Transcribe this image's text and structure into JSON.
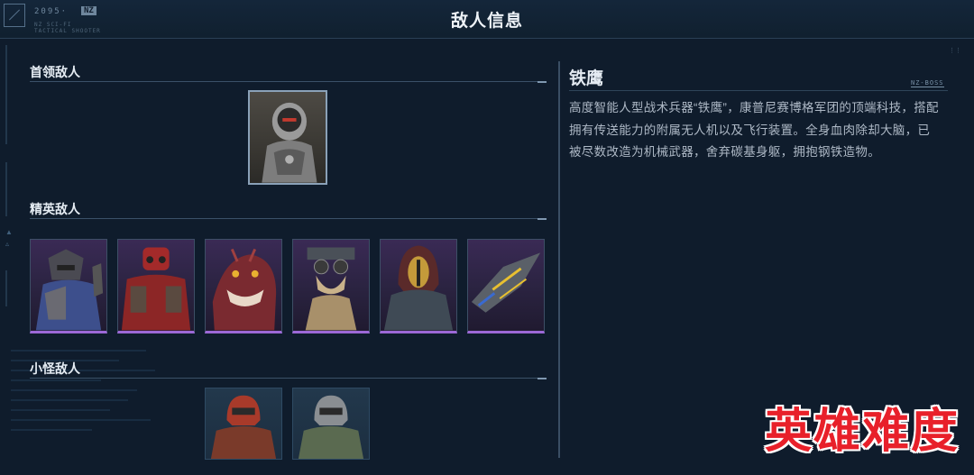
{
  "header": {
    "brand_text": "2095·",
    "brand_tag": "NZ",
    "brand_sub": "NZ SCI-FI TACTICAL SHOOTER",
    "title": "敌人信息"
  },
  "sections": {
    "boss": {
      "label": "首领敌人"
    },
    "elite": {
      "label": "精英敌人"
    },
    "minion": {
      "label": "小怪敌人"
    }
  },
  "boss_cards": [
    {
      "name": "铁鹰",
      "icon": "armored-cyborg-portrait"
    }
  ],
  "elite_cards": [
    {
      "icon": "blue-armored-brute-portrait"
    },
    {
      "icon": "red-heavy-mech-portrait"
    },
    {
      "icon": "red-beast-monster-portrait"
    },
    {
      "icon": "goggle-mutant-portrait"
    },
    {
      "icon": "hooded-gold-mask-portrait"
    },
    {
      "icon": "fighter-drone-portrait"
    }
  ],
  "minion_cards": [
    {
      "icon": "red-helmet-soldier-portrait"
    },
    {
      "icon": "silver-helmet-soldier-portrait"
    }
  ],
  "detail": {
    "name": "铁鹰",
    "corner_tag": "NZ-BOSS",
    "description": "高度智能人型战术兵器“铁鹰”，康普尼赛博格军团的顶端科技，搭配拥有传送能力的附属无人机以及飞行装置。全身血肉除却大脑，已被尽数改造为机械武器，舍弃碳基身躯，拥抱钢铁造物。"
  },
  "overlay": {
    "difficulty": "英雄难度"
  },
  "colors": {
    "background": "#0f1c2c",
    "elite_accent": "#9c68d6",
    "difficulty_red": "#e8202a"
  }
}
